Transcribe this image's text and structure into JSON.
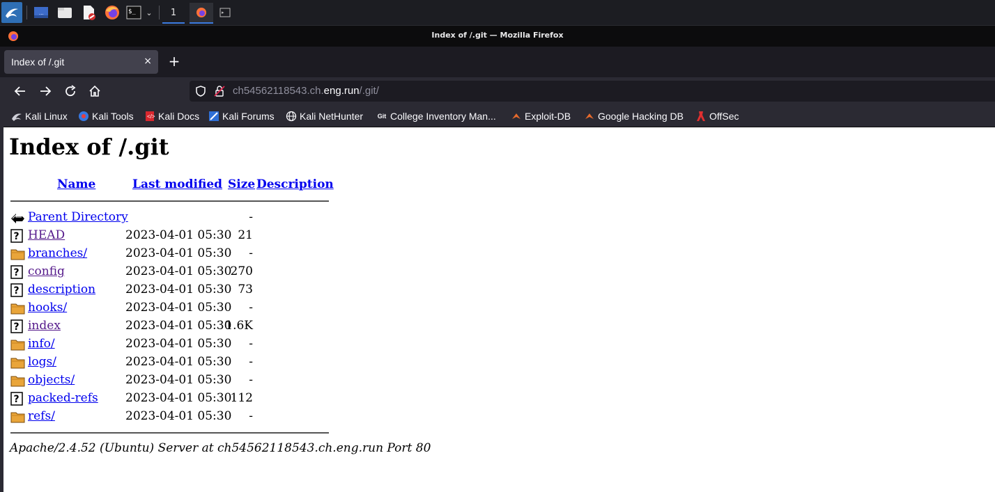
{
  "taskbar": {
    "workspace": "1"
  },
  "window": {
    "title": "Index of /.git — Mozilla Firefox"
  },
  "tab": {
    "label": "Index of /.git",
    "close": "×",
    "new_tab": "+"
  },
  "urlbar": {
    "prefix": "ch54562118543.ch.",
    "host": "eng.run",
    "path": "/.git/"
  },
  "bookmarks": [
    {
      "label": "Kali Linux",
      "icon": "kali-dragon-icon"
    },
    {
      "label": "Kali Tools",
      "icon": "kali-tools-icon"
    },
    {
      "label": "Kali Docs",
      "icon": "kali-docs-icon"
    },
    {
      "label": "Kali Forums",
      "icon": "kali-forums-icon"
    },
    {
      "label": "Kali NetHunter",
      "icon": "globe-icon"
    },
    {
      "label": "College Inventory Man...",
      "icon": "git-icon"
    },
    {
      "label": "Exploit-DB",
      "icon": "exploit-db-icon"
    },
    {
      "label": "Google Hacking DB",
      "icon": "ghdb-icon"
    },
    {
      "label": "OffSec",
      "icon": "offsec-icon"
    }
  ],
  "page": {
    "heading": "Index of /.git",
    "columns": {
      "name": "Name",
      "modified": "Last modified",
      "size": "Size",
      "description": "Description"
    },
    "rows": [
      {
        "name": "Parent Directory",
        "modified": "",
        "size": "-",
        "type": "parent",
        "visited": false
      },
      {
        "name": "HEAD",
        "modified": "2023-04-01 05:30",
        "size": "21",
        "type": "file",
        "visited": true
      },
      {
        "name": "branches/",
        "modified": "2023-04-01 05:30",
        "size": "-",
        "type": "folder",
        "visited": false
      },
      {
        "name": "config",
        "modified": "2023-04-01 05:30",
        "size": "270",
        "type": "file",
        "visited": true
      },
      {
        "name": "description",
        "modified": "2023-04-01 05:30",
        "size": "73",
        "type": "file",
        "visited": false
      },
      {
        "name": "hooks/",
        "modified": "2023-04-01 05:30",
        "size": "-",
        "type": "folder",
        "visited": false
      },
      {
        "name": "index",
        "modified": "2023-04-01 05:30",
        "size": "1.6K",
        "type": "file",
        "visited": true
      },
      {
        "name": "info/",
        "modified": "2023-04-01 05:30",
        "size": "-",
        "type": "folder",
        "visited": false
      },
      {
        "name": "logs/",
        "modified": "2023-04-01 05:30",
        "size": "-",
        "type": "folder",
        "visited": false
      },
      {
        "name": "objects/",
        "modified": "2023-04-01 05:30",
        "size": "-",
        "type": "folder",
        "visited": false
      },
      {
        "name": "packed-refs",
        "modified": "2023-04-01 05:30",
        "size": "112",
        "type": "file",
        "visited": false
      },
      {
        "name": "refs/",
        "modified": "2023-04-01 05:30",
        "size": "-",
        "type": "folder",
        "visited": false
      }
    ],
    "footer": "Apache/2.4.52 (Ubuntu) Server at ch54562118543.ch.eng.run Port 80"
  }
}
